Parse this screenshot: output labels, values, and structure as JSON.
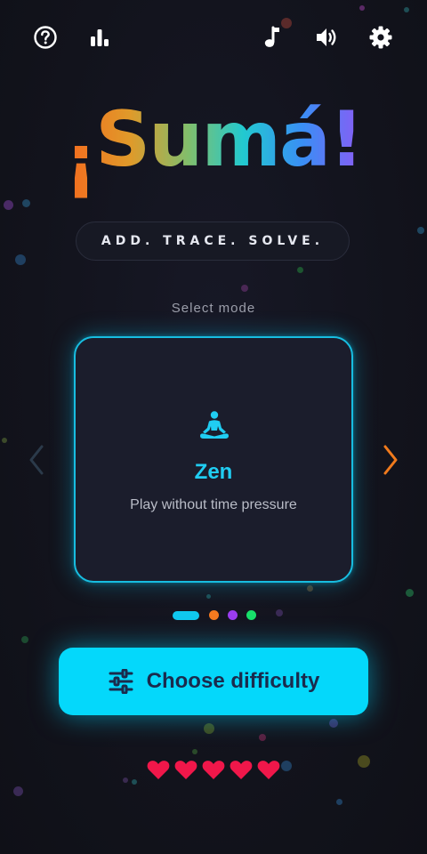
{
  "app": {
    "title_prefix": "¡",
    "title_main": "Sumá!"
  },
  "topbar": {
    "left_icons": [
      "help-circle-icon",
      "stats-bar-icon"
    ],
    "right_icons": [
      "music-note-icon",
      "volume-icon",
      "gear-icon"
    ]
  },
  "tagline": "ADD. TRACE. SOLVE.",
  "mode_select": {
    "label": "Select mode",
    "current": {
      "icon": "meditation-icon",
      "title": "Zen",
      "description": "Play without time pressure"
    },
    "pages": 4,
    "active_page": 0,
    "page_colors": [
      "#10c8ee",
      "#f47a1f",
      "#9b3df0",
      "#18e06a"
    ]
  },
  "cta": {
    "label": "Choose difficulty",
    "icon": "sliders-icon"
  },
  "lives": {
    "count": 5,
    "icon": "heart-icon",
    "color": "#f0174a"
  },
  "colors": {
    "accent": "#04d8fb",
    "background": "#12131c",
    "arrow_next": "#f07a1c"
  }
}
